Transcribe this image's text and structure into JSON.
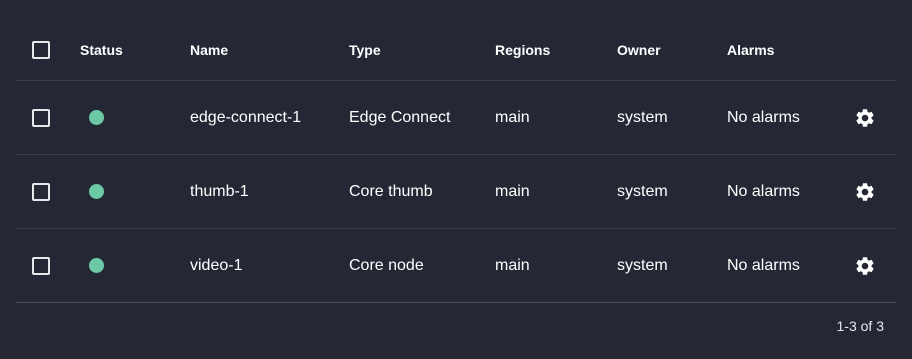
{
  "table": {
    "headers": {
      "status": "Status",
      "name": "Name",
      "type": "Type",
      "regions": "Regions",
      "owner": "Owner",
      "alarms": "Alarms"
    },
    "rows": [
      {
        "status": "ok",
        "status_color": "#6cc9a5",
        "name": "edge-connect-1",
        "type": "Edge Connect",
        "regions": "main",
        "owner": "system",
        "alarms": "No alarms",
        "action_icon": "gear-icon"
      },
      {
        "status": "ok",
        "status_color": "#6cc9a5",
        "name": "thumb-1",
        "type": "Core thumb",
        "regions": "main",
        "owner": "system",
        "alarms": "No alarms",
        "action_icon": "gear-icon"
      },
      {
        "status": "ok",
        "status_color": "#6cc9a5",
        "name": "video-1",
        "type": "Core node",
        "regions": "main",
        "owner": "system",
        "alarms": "No alarms",
        "action_icon": "gear-icon"
      }
    ]
  },
  "pagination": {
    "label": "1-3 of 3"
  },
  "colors": {
    "background": "#232834",
    "divider": "#3a3f4b",
    "status_ok": "#6cc9a5",
    "text": "#ffffff"
  }
}
